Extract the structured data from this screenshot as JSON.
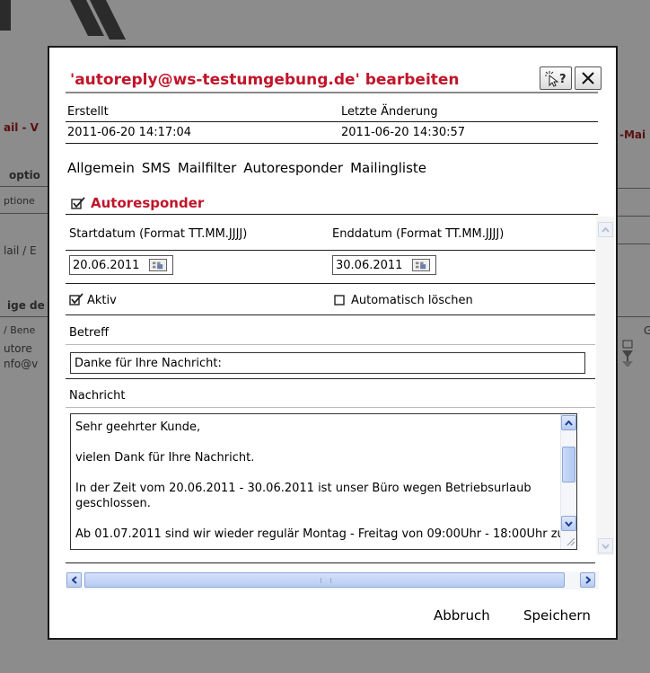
{
  "background": {
    "fragments": {
      "mail_v": "ail - V",
      "right_mai": "-Mai",
      "optio": "optio",
      "optione": "ptione",
      "mail_e": "lail / E",
      "ige_d": "ige de",
      "bene": "/ Bene",
      "g": "G",
      "autore": "utore",
      "nfo": "nfo@v"
    }
  },
  "dialog": {
    "title": "'autoreply@ws-testumgebung.de' bearbeiten",
    "help_label": "?",
    "close_label": "×",
    "meta": {
      "created_label": "Erstellt",
      "created_value": "2011-06-20 14:17:04",
      "modified_label": "Letzte Änderung",
      "modified_value": "2011-06-20 14:30:57"
    },
    "tabs": [
      "Allgemein",
      "SMS",
      "Mailfilter",
      "Autoresponder",
      "Mailingliste"
    ],
    "section": {
      "title": "Autoresponder",
      "checked": true
    },
    "form": {
      "start_label": "Startdatum (Format TT.MM.JJJJ)",
      "start_value": "20.06.2011",
      "end_label": "Enddatum (Format TT.MM.JJJJ)",
      "end_value": "30.06.2011",
      "active_label": "Aktiv",
      "active_checked": true,
      "autodelete_label": "Automatisch löschen",
      "autodelete_checked": false,
      "subject_label": "Betreff",
      "subject_value": "Danke für Ihre Nachricht:",
      "message_label": "Nachricht",
      "message_lines": [
        "Sehr geehrter Kunde,",
        "vielen Dank für Ihre Nachricht.",
        "In der Zeit vom 20.06.2011 - 30.06.2011 ist unser Büro wegen Betriebsurlaub geschlossen.",
        "Ab 01.07.2011 sind wir wieder regulär Montag - Freitag von 09:00Uhr - 18:00Uhr zu"
      ]
    },
    "buttons": {
      "cancel": "Abbruch",
      "save": "Speichern"
    }
  },
  "colors": {
    "accent_red": "#c0152a",
    "overlay_gray": "#8c8c8c",
    "scrollbar_blue": "#b9cbf0"
  },
  "icons": [
    "help-cursor-icon",
    "close-icon",
    "calendar-icon",
    "checkbox-checked-icon",
    "checkbox-unchecked-icon",
    "scroll-up-icon",
    "scroll-down-icon",
    "scroll-left-icon",
    "scroll-right-icon",
    "resize-grip-icon",
    "filter-icon"
  ]
}
